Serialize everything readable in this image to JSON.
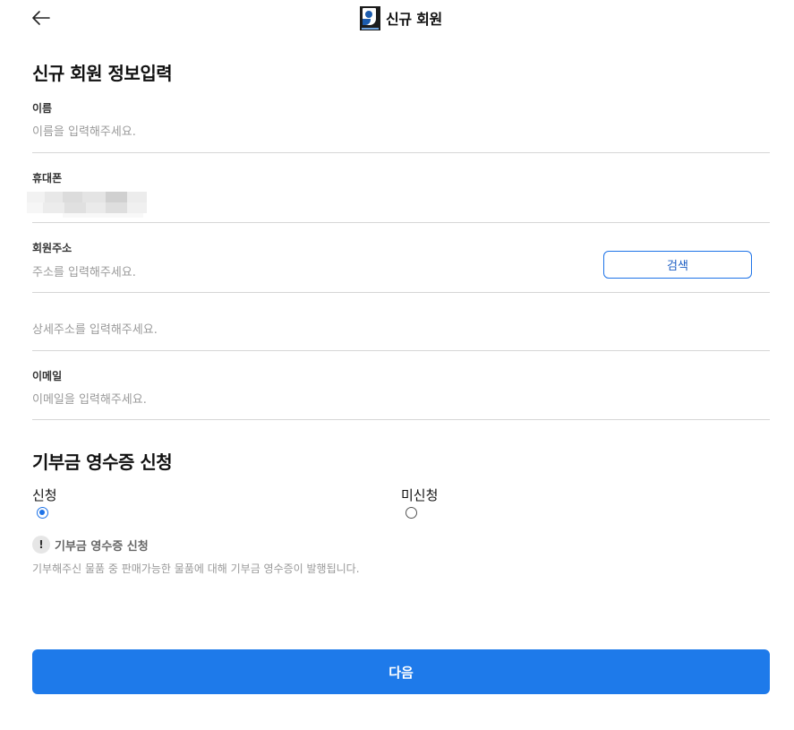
{
  "header": {
    "back_icon": "arrow-left-icon",
    "logo_icon": "goodwill-logo",
    "title": "신규 회원"
  },
  "form": {
    "section_title": "신규 회원 정보입력",
    "name": {
      "label": "이름",
      "placeholder": "이름을 입력해주세요."
    },
    "phone": {
      "label": "휴대폰",
      "value_masked": true
    },
    "address": {
      "label": "회원주소",
      "placeholder": "주소를 입력해주세요.",
      "search_label": "검색",
      "detail_placeholder": "상세주소를 입력해주세요."
    },
    "email": {
      "label": "이메일",
      "placeholder": "이메일을 입력해주세요."
    }
  },
  "receipt": {
    "section_title": "기부금 영수증 신청",
    "options": [
      {
        "label": "신청",
        "checked": true
      },
      {
        "label": "미신청",
        "checked": false
      }
    ],
    "notice_icon": "exclamation-icon",
    "notice_icon_glyph": "!",
    "notice_title": "기부금 영수증 신청",
    "notice_desc": "기부해주신 물품 중 판매가능한 물품에 대해 기부금 영수증이 발행됩니다."
  },
  "footer": {
    "next_label": "다음"
  },
  "colors": {
    "accent": "#1e7aea",
    "divider": "#d6d6d6",
    "placeholder": "#9a9a9a"
  }
}
